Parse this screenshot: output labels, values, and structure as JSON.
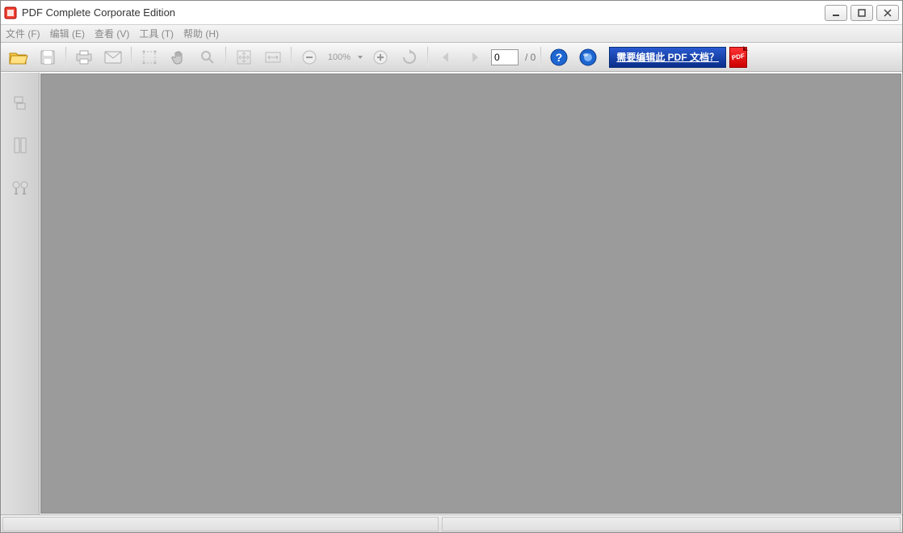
{
  "title": "PDF Complete Corporate Edition",
  "menus": {
    "file": "文件 (F)",
    "edit": "编辑 (E)",
    "view": "查看 (V)",
    "tools": "工具 (T)",
    "help": "帮助 (H)"
  },
  "toolbar": {
    "zoom_level": "100%",
    "page_input": "0",
    "page_total": "/ 0"
  },
  "promo": {
    "text": "需要编辑此 PDF 文档？",
    "icon_label": "PDF"
  }
}
